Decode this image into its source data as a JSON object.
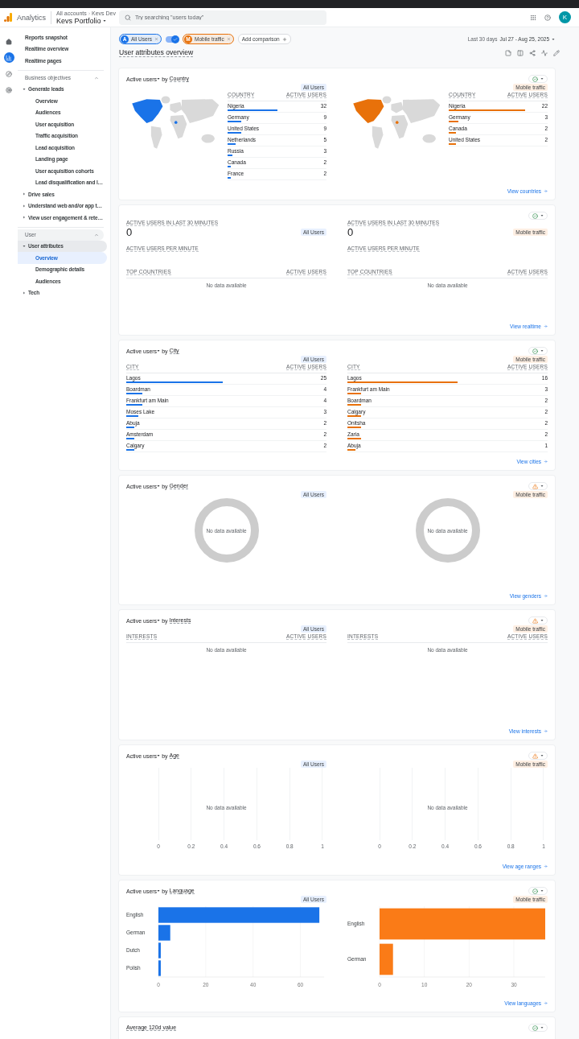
{
  "app": {
    "name": "Analytics",
    "breadcrumb": [
      "All accounts",
      "Kevs Dev"
    ],
    "property": "Kevs Portfolio",
    "avatar": "K"
  },
  "search": {
    "placeholder": "Try searching \"users today\""
  },
  "rail": [
    {
      "kind": "home",
      "selected": false
    },
    {
      "kind": "reports",
      "selected": true
    },
    {
      "kind": "explore",
      "selected": false
    },
    {
      "kind": "advertising",
      "selected": false
    }
  ],
  "sidebar": {
    "items": [
      {
        "label": "Reports snapshot",
        "selected": false
      },
      {
        "label": "Realtime overview",
        "selected": false
      },
      {
        "label": "Realtime pages",
        "selected": false
      }
    ],
    "sections": [
      {
        "title": "Business objectives",
        "expanded": true,
        "items": [
          {
            "label": "Generate leads",
            "expanded": true,
            "selected": false,
            "children": [
              {
                "label": "Overview",
                "selected": false
              },
              {
                "label": "Audiences",
                "selected": false
              },
              {
                "label": "User acquisition",
                "selected": false
              },
              {
                "label": "Traffic acquisition",
                "selected": false
              },
              {
                "label": "Lead acquisition",
                "selected": false
              },
              {
                "label": "Landing page",
                "selected": false
              },
              {
                "label": "User acquisition cohorts",
                "selected": false
              },
              {
                "label": "Lead disqualification and l…",
                "selected": false
              }
            ]
          },
          {
            "label": "Drive sales",
            "expanded": false,
            "selected": false
          },
          {
            "label": "Understand web and/or app t…",
            "expanded": false,
            "selected": false
          },
          {
            "label": "View user engagement & rete…",
            "expanded": false,
            "selected": false
          }
        ]
      },
      {
        "title": "User",
        "expanded": true,
        "items": [
          {
            "label": "User attributes",
            "expanded": true,
            "selected": false,
            "children": [
              {
                "label": "Overview",
                "selected": true
              },
              {
                "label": "Demographic details",
                "selected": false
              },
              {
                "label": "Audiences",
                "selected": false
              }
            ]
          },
          {
            "label": "Tech",
            "expanded": false,
            "selected": false
          }
        ]
      }
    ]
  },
  "comparisons": [
    {
      "letter": "A",
      "label": "All Users",
      "color": "#1a73e8"
    },
    {
      "letter": "M",
      "label": "Mobile traffic",
      "color": "#e8710a"
    }
  ],
  "compare_toggle": {
    "on": true
  },
  "add_comparison": "Add comparison",
  "date_range": {
    "label": "Last 30 days",
    "value": "Jul 27 - Aug 25, 2025"
  },
  "page_title": "User attributes overview",
  "cards": [
    {
      "kind": "map_table",
      "metric": "Active users",
      "joiner": "by",
      "dimension": "Country",
      "warning": false,
      "link": "View countries",
      "panels": [
        {
          "segment": "All Users",
          "color": "#1a73e8",
          "columns": [
            "COUNTRY",
            "ACTIVE USERS"
          ],
          "rows": [
            {
              "name": "Nigeria",
              "value": "32",
              "level": 0.5
            },
            {
              "name": "Germany",
              "value": "9",
              "level": 0.14
            },
            {
              "name": "United States",
              "value": "9",
              "level": 0.14
            },
            {
              "name": "Netherlands",
              "value": "5",
              "level": 0.08
            },
            {
              "name": "Russia",
              "value": "3",
              "level": 0.05
            },
            {
              "name": "Canada",
              "value": "2",
              "level": 0.03
            },
            {
              "name": "France",
              "value": "2",
              "level": 0.03
            }
          ]
        },
        {
          "segment": "Mobile traffic",
          "color": "#e8710a",
          "columns": [
            "COUNTRY",
            "ACTIVE USERS"
          ],
          "rows": [
            {
              "name": "Nigeria",
              "value": "22",
              "level": 0.77
            },
            {
              "name": "Germany",
              "value": "3",
              "level": 0.1
            },
            {
              "name": "Canada",
              "value": "2",
              "level": 0.07
            },
            {
              "name": "United States",
              "value": "2",
              "level": 0.07
            }
          ]
        }
      ]
    },
    {
      "kind": "realtime",
      "warning": false,
      "link": "View realtime",
      "panels": [
        {
          "segment": "All Users",
          "label": "ACTIVE USERS IN LAST 30 MINUTES",
          "value": "0",
          "sublabel": "ACTIVE USERS PER MINUTE",
          "columns": [
            "TOP COUNTRIES",
            "ACTIVE USERS"
          ],
          "empty": "No data available"
        },
        {
          "segment": "Mobile traffic",
          "label": "ACTIVE USERS IN LAST 30 MINUTES",
          "value": "0",
          "sublabel": "ACTIVE USERS PER MINUTE",
          "columns": [
            "TOP COUNTRIES",
            "ACTIVE USERS"
          ],
          "empty": "No data available"
        }
      ]
    },
    {
      "kind": "table",
      "metric": "Active users",
      "joiner": "by",
      "dimension": "City",
      "warning": false,
      "link": "View cities",
      "panels": [
        {
          "segment": "All Users",
          "color": "#1a73e8",
          "columns": [
            "CITY",
            "ACTIVE USERS"
          ],
          "rows": [
            {
              "name": "Lagos",
              "value": "25",
              "level": 0.48
            },
            {
              "name": "Boardman",
              "value": "4",
              "level": 0.08
            },
            {
              "name": "Frankfurt am Main",
              "value": "4",
              "level": 0.08
            },
            {
              "name": "Moses Lake",
              "value": "3",
              "level": 0.06
            },
            {
              "name": "Abuja",
              "value": "2",
              "level": 0.04
            },
            {
              "name": "Amsterdam",
              "value": "2",
              "level": 0.04
            },
            {
              "name": "Calgary",
              "value": "2",
              "level": 0.04
            }
          ]
        },
        {
          "segment": "Mobile traffic",
          "color": "#e8710a",
          "columns": [
            "CITY",
            "ACTIVE USERS"
          ],
          "rows": [
            {
              "name": "Lagos",
              "value": "16",
              "level": 0.55
            },
            {
              "name": "Frankfurt am Main",
              "value": "3",
              "level": 0.07
            },
            {
              "name": "Boardman",
              "value": "2",
              "level": 0.07
            },
            {
              "name": "Calgary",
              "value": "2",
              "level": 0.07
            },
            {
              "name": "Onitsha",
              "value": "2",
              "level": 0.07
            },
            {
              "name": "Zaria",
              "value": "2",
              "level": 0.07
            },
            {
              "name": "Abuja",
              "value": "1",
              "level": 0.04
            }
          ]
        }
      ]
    },
    {
      "kind": "donut",
      "metric": "Active users",
      "joiner": "by",
      "dimension": "Gender",
      "warning": true,
      "link": "View genders",
      "panels": [
        {
          "segment": "All Users",
          "empty": "No data available"
        },
        {
          "segment": "Mobile traffic",
          "empty": "No data available"
        }
      ]
    },
    {
      "kind": "table",
      "metric": "Active users",
      "joiner": "by",
      "dimension": "Interests",
      "warning": true,
      "link": "View interests",
      "panels": [
        {
          "segment": "All Users",
          "columns": [
            "INTERESTS",
            "ACTIVE USERS"
          ],
          "empty": "No data available"
        },
        {
          "segment": "Mobile traffic",
          "columns": [
            "INTERESTS",
            "ACTIVE USERS"
          ],
          "empty": "No data available"
        }
      ]
    },
    {
      "kind": "axis",
      "metric": "Active users",
      "joiner": "by",
      "dimension": "Age",
      "warning": true,
      "link": "View age ranges",
      "panels": [
        {
          "segment": "All Users",
          "ticks": [
            "0",
            "0.2",
            "0.4",
            "0.6",
            "0.8",
            "1"
          ],
          "empty": "No data available"
        },
        {
          "segment": "Mobile traffic",
          "ticks": [
            "0",
            "0.2",
            "0.4",
            "0.6",
            "0.8",
            "1"
          ],
          "empty": "No data available"
        }
      ]
    },
    {
      "kind": "bar",
      "metric": "Active users",
      "joiner": "by",
      "dimension": "Language",
      "warning": false,
      "link": "View languages",
      "panels": [
        {
          "segment": "All Users",
          "chart_data": {
            "type": "bar",
            "orientation": "horizontal",
            "categories": [
              "English",
              "German",
              "Dutch",
              "Polish"
            ],
            "xlim": [
              0,
              70
            ],
            "xticks": [
              0,
              20,
              40,
              60
            ],
            "grid": true,
            "series": [
              {
                "color": "#1a73e8",
                "values": [
                  68,
                  5,
                  1,
                  1
                ]
              }
            ]
          }
        },
        {
          "segment": "Mobile traffic",
          "chart_data": {
            "type": "bar",
            "orientation": "horizontal",
            "categories": [
              "English",
              "German"
            ],
            "xlim": [
              0,
              37
            ],
            "xticks": [
              0,
              10,
              20,
              30
            ],
            "grid": true,
            "series": [
              {
                "color": "#fa7b17",
                "values": [
                  37,
                  3
                ]
              }
            ]
          }
        }
      ]
    },
    {
      "kind": "partial",
      "title": "Average 120d value",
      "warning": false
    }
  ]
}
